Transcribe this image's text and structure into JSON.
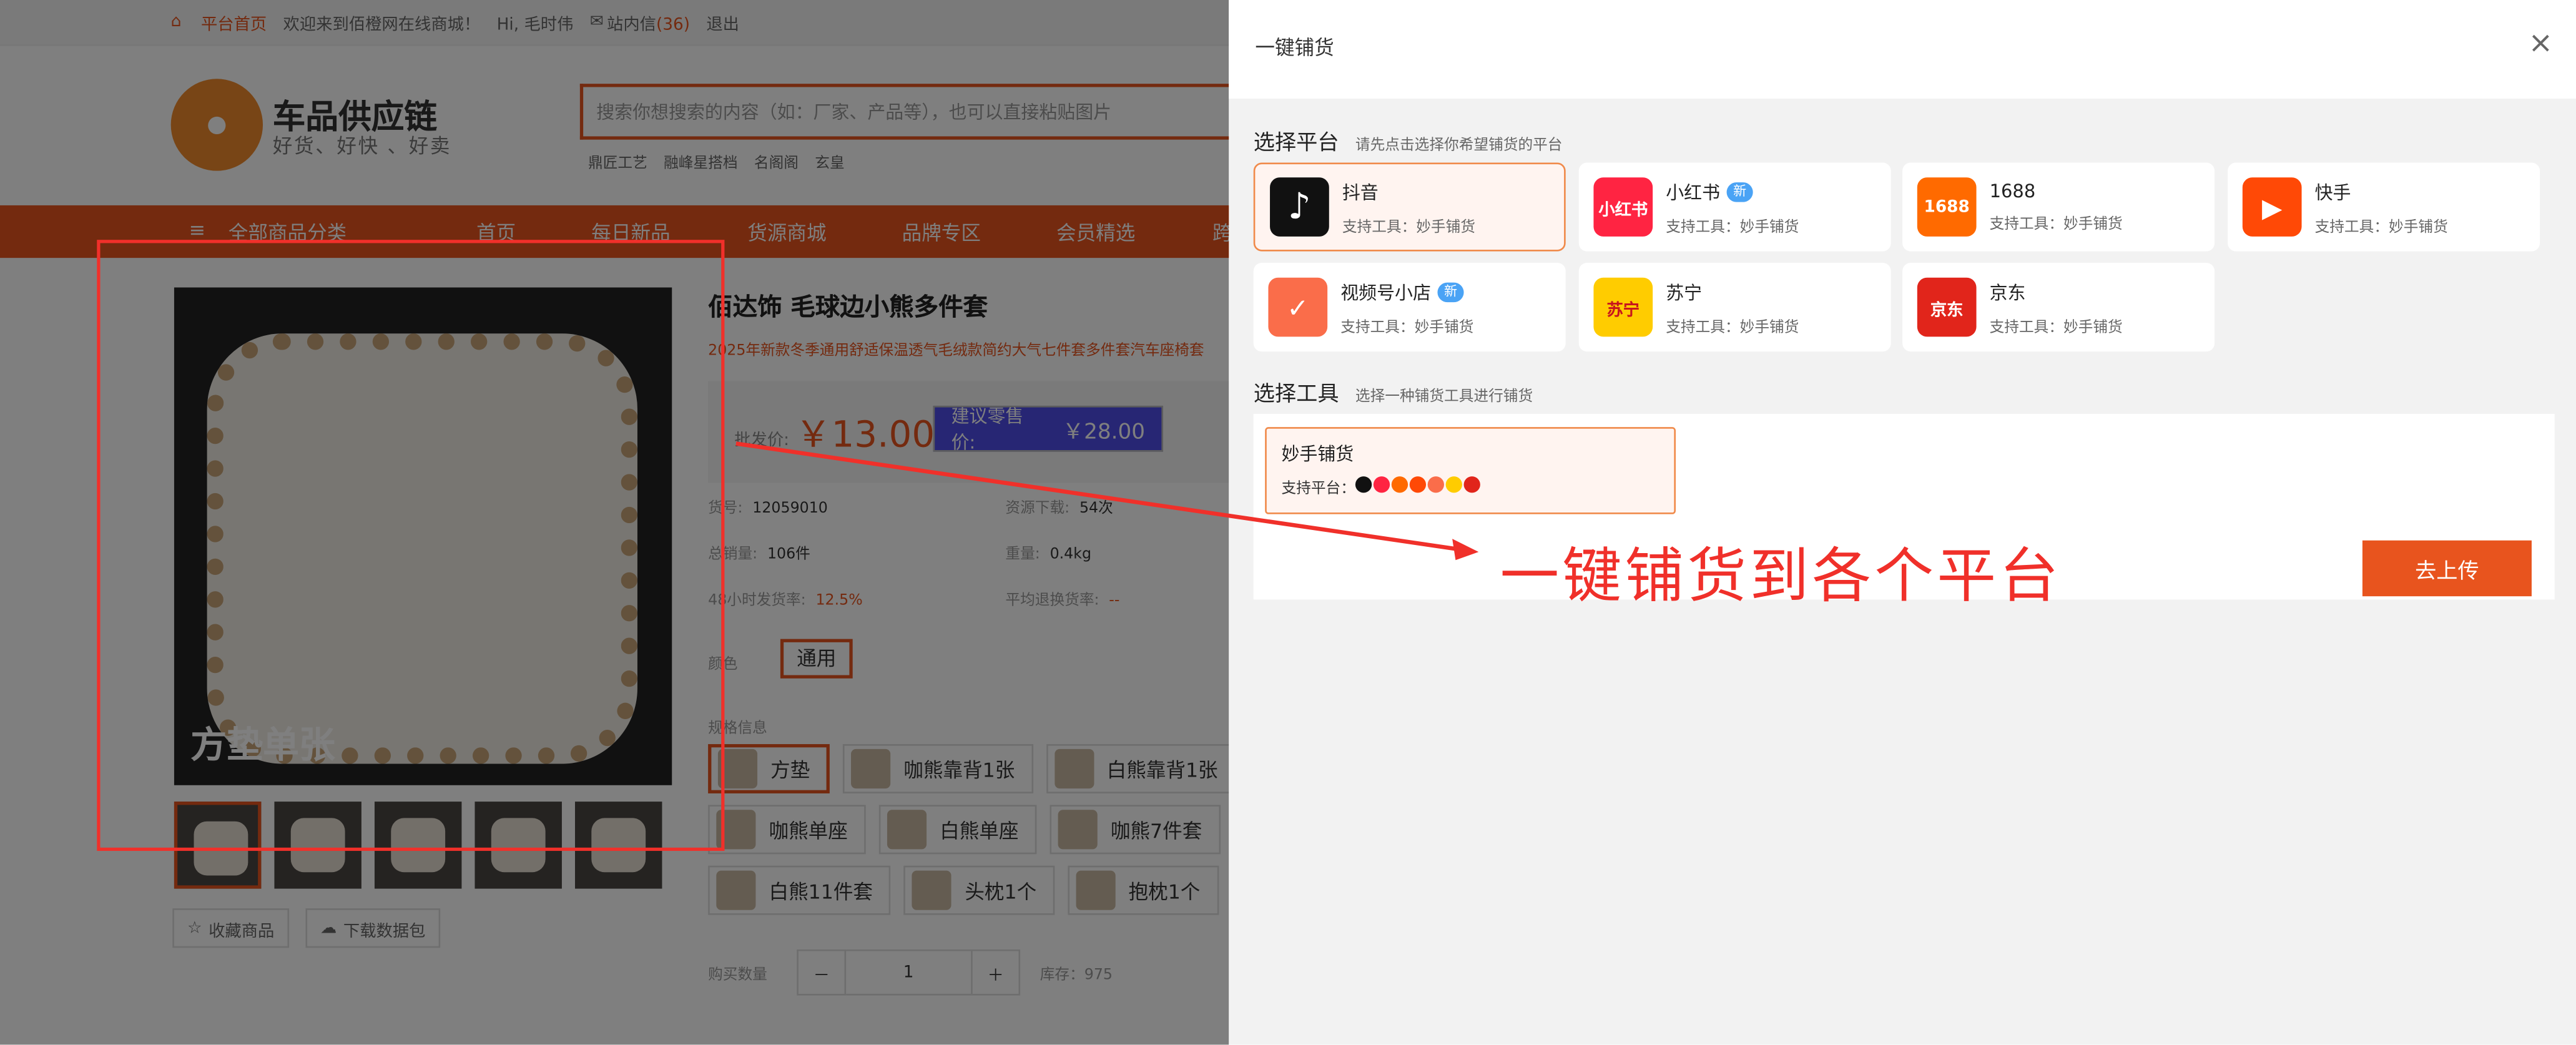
{
  "topbar": {
    "home": "平台首页",
    "welcome": "欢迎来到佰橙网在线商城！",
    "user": "Hi, 毛时伟",
    "inbox": "站内信",
    "inbox_count": "(36)",
    "logout": "退出"
  },
  "header": {
    "brand": "车品供应链",
    "slogan": "好货、好快 、好卖",
    "search_placeholder": "搜索你想搜索的内容（如：厂家、产品等），也可以直接粘贴图片",
    "tags": [
      "鼎匠工艺",
      "融峰星搭档",
      "名阁阁",
      "玄皇"
    ]
  },
  "nav": {
    "menu_icon": "≡",
    "items": [
      "全部商品分类",
      "首页",
      "每日新品",
      "货源商城",
      "品牌专区",
      "会员精选",
      "跨"
    ]
  },
  "product": {
    "image_caption": "方垫单张",
    "title": "佰达饰 毛球边小熊多件套",
    "subtitle": "2025年新款冬季通用舒适保温透气毛绒款简约大气七件套多件套汽车座椅套",
    "price_label": "批发价:",
    "price": "￥13.00",
    "suggest_label": "建议零售价:",
    "suggest_price": "￥28.00",
    "info": [
      {
        "label": "货号:",
        "value": "12059010"
      },
      {
        "label": "资源下载:",
        "value": "54次"
      },
      {
        "label": "总销量:",
        "value": "106件"
      },
      {
        "label": "重量:",
        "value": "0.4kg"
      },
      {
        "label": "48小时发货率:",
        "value": "12.5%"
      },
      {
        "label": "平均退换货率:",
        "value": "--"
      }
    ],
    "color_label": "颜色",
    "color_value": "通用",
    "spec_label": "规格信息",
    "specs": [
      "方垫",
      "咖熊靠背1张",
      "白熊靠背1张",
      "咖熊单座",
      "白熊单座",
      "咖熊7件套",
      "白熊11件套",
      "头枕1个",
      "抱枕1个"
    ],
    "favorite": "收藏商品",
    "download": "下载数据包",
    "qty_label": "购买数量",
    "qty_minus": "－",
    "qty_value": "1",
    "qty_plus": "＋",
    "stock": "库存：975"
  },
  "panel": {
    "title": "一键铺货",
    "close": "×",
    "platform_section": "选择平台",
    "platform_hint": "请先点击选择你希望铺货的平台",
    "platforms": [
      {
        "name": "抖音",
        "tool": "支持工具：妙手铺货",
        "icon": "douyin-icon",
        "color": "#111111",
        "glyph": "♪"
      },
      {
        "name": "小红书",
        "tool": "支持工具：妙手铺货",
        "badge": "新",
        "icon": "xiaohongshu-icon",
        "color": "#ff2442",
        "glyph": "小红书"
      },
      {
        "name": "1688",
        "tool": "支持工具：妙手铺货",
        "icon": "alibaba-1688-icon",
        "color": "#ff6a00",
        "glyph": "1688"
      },
      {
        "name": "快手",
        "tool": "支持工具：妙手铺货",
        "icon": "kuaishou-icon",
        "color": "#ff4906",
        "glyph": "▶"
      },
      {
        "name": "视频号小店",
        "tool": "支持工具：妙手铺货",
        "badge": "新",
        "icon": "weixin-shop-icon",
        "color": "#fa6d4a",
        "glyph": "✓"
      },
      {
        "name": "苏宁",
        "tool": "支持工具：妙手铺货",
        "icon": "suning-icon",
        "color": "#ffcc00",
        "glyph": "苏宁"
      },
      {
        "name": "京东",
        "tool": "支持工具：妙手铺货",
        "icon": "jd-icon",
        "color": "#e1251b",
        "glyph": "京东"
      }
    ],
    "tool_section": "选择工具",
    "tool_hint": "选择一种铺货工具进行铺货",
    "tool_name": "妙手铺货",
    "tool_support_label": "支持平台：",
    "upload": "去上传"
  },
  "annotation": {
    "text": "一键铺货到各个平台"
  },
  "colors": {
    "accent": "#e8541e",
    "annotation_red": "#f0302a"
  }
}
